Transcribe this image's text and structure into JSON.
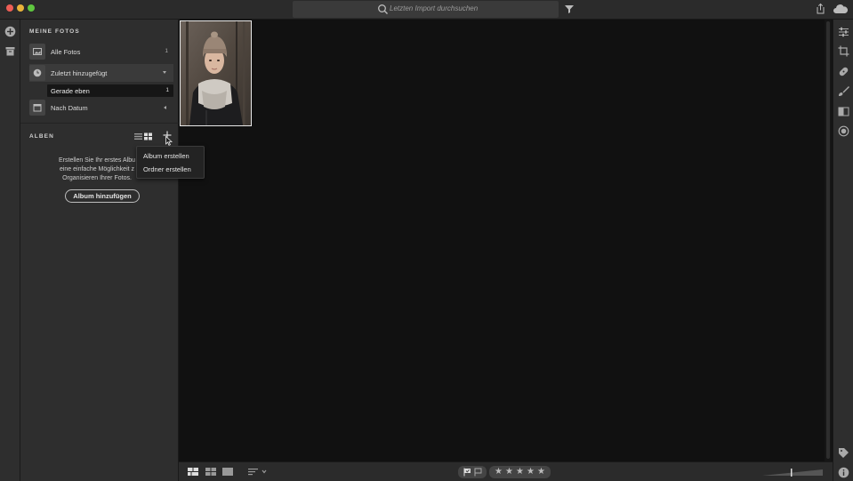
{
  "search": {
    "placeholder": "Letzten Import durchsuchen"
  },
  "sidebar": {
    "my_photos_title": "MEINE FOTOS",
    "items": [
      {
        "label": "Alle Fotos",
        "count": "1",
        "icon": "photo-icon"
      },
      {
        "label": "Zuletzt hinzugefügt",
        "icon": "clock-icon",
        "expanded": true
      },
      {
        "label": "Nach Datum",
        "icon": "calendar-icon",
        "expanded": false
      }
    ],
    "sub_items": [
      {
        "label": "Gerade eben",
        "count": "1"
      }
    ],
    "albums_title": "ALBEN",
    "empty_text": [
      "Erstellen Sie Ihr erstes Albu",
      "eine einfache Möglichkeit z",
      "Organisieren Ihrer Fotos."
    ],
    "add_album_label": "Album hinzufügen"
  },
  "menu": {
    "items": [
      "Album erstellen",
      "Ordner erstellen"
    ]
  },
  "grid": {
    "photos": [
      {
        "subject": "woman in knit beanie and scarf, winter forest"
      }
    ]
  },
  "bottombar": {
    "stars": [
      "★",
      "★",
      "★",
      "★",
      "★"
    ]
  },
  "colors": {
    "background": "#111111",
    "panel": "#2e2e2e",
    "selection": "#161616",
    "accent_text": "#dddddd"
  }
}
